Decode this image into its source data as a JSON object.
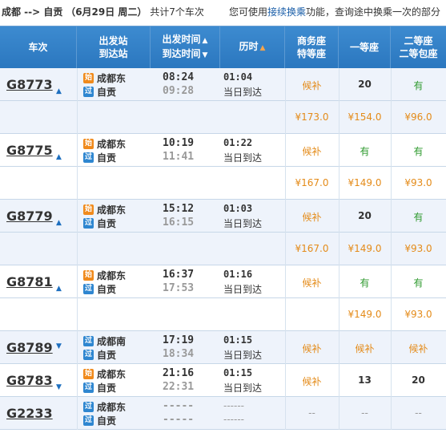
{
  "summary": {
    "route": "成都 --> 自贡",
    "date": "（6月29日 周二）",
    "count_text": "共计7个车次",
    "tip_prefix": "您可使用",
    "tip_link": "接续换乘",
    "tip_suffix": "功能，查询途中换乘一次的部分"
  },
  "header": {
    "train": "车次",
    "station_top": "出发站",
    "station_bottom": "到达站",
    "time_top": "出发时间",
    "time_bottom": "到达时间",
    "duration": "历时",
    "business_top": "商务座",
    "business_bottom": "特等座",
    "first": "一等座",
    "second_top": "二等座",
    "second_bottom": "二等包座"
  },
  "trains": [
    {
      "no": "G8773",
      "tri": "▲",
      "from_badge": "始",
      "from": "成都东",
      "to_badge": "过",
      "to": "自贡",
      "dep": "08:24",
      "arr": "09:28",
      "dur": "01:04",
      "arrive_day": "当日到达",
      "business": "候补",
      "first": "20",
      "second": "有",
      "prices": {
        "business": "¥173.0",
        "first": "¥154.0",
        "second": "¥96.0"
      }
    },
    {
      "no": "G8775",
      "tri": "▲",
      "from_badge": "始",
      "from": "成都东",
      "to_badge": "过",
      "to": "自贡",
      "dep": "10:19",
      "arr": "11:41",
      "dur": "01:22",
      "arrive_day": "当日到达",
      "business": "候补",
      "first": "有",
      "second": "有",
      "prices": {
        "business": "¥167.0",
        "first": "¥149.0",
        "second": "¥93.0"
      }
    },
    {
      "no": "G8779",
      "tri": "▲",
      "from_badge": "始",
      "from": "成都东",
      "to_badge": "过",
      "to": "自贡",
      "dep": "15:12",
      "arr": "16:15",
      "dur": "01:03",
      "arrive_day": "当日到达",
      "business": "候补",
      "first": "20",
      "second": "有",
      "prices": {
        "business": "¥167.0",
        "first": "¥149.0",
        "second": "¥93.0"
      }
    },
    {
      "no": "G8781",
      "tri": "▲",
      "from_badge": "始",
      "from": "成都东",
      "to_badge": "过",
      "to": "自贡",
      "dep": "16:37",
      "arr": "17:53",
      "dur": "01:16",
      "arrive_day": "当日到达",
      "business": "候补",
      "first": "有",
      "second": "有",
      "prices": {
        "business": "",
        "first": "¥149.0",
        "second": "¥93.0"
      }
    },
    {
      "no": "G8789",
      "tri": "▼",
      "from_badge": "过",
      "from": "成都南",
      "to_badge": "过",
      "to": "自贡",
      "dep": "17:19",
      "arr": "18:34",
      "dur": "01:15",
      "arrive_day": "当日到达",
      "business": "候补",
      "first": "候补",
      "second": "候补"
    },
    {
      "no": "G8783",
      "tri": "▼",
      "from_badge": "始",
      "from": "成都东",
      "to_badge": "过",
      "to": "自贡",
      "dep": "21:16",
      "arr": "22:31",
      "dur": "01:15",
      "arrive_day": "当日到达",
      "business": "候补",
      "first": "13",
      "second": "20"
    },
    {
      "no": "G2233",
      "tri": "",
      "from_badge": "过",
      "from": "成都东",
      "to_badge": "过",
      "to": "自贡",
      "dep": "-----",
      "arr": "-----",
      "dur": "------",
      "arrive_day": "------",
      "business": "--",
      "first": "--",
      "second": "--"
    }
  ],
  "colors": {
    "header_bg": "#2b77bf",
    "orange": "#e48b19",
    "green": "#2e9a2e",
    "alt_row": "#eef3fb"
  }
}
